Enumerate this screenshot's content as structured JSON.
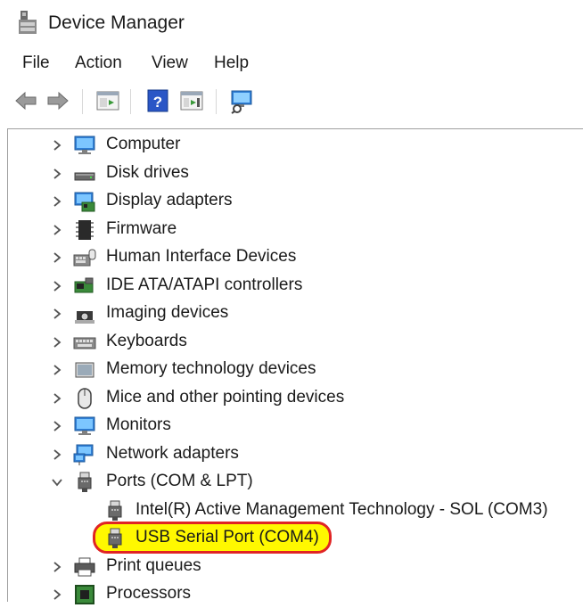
{
  "window": {
    "title": "Device Manager",
    "icon": "device-manager-icon"
  },
  "menu": [
    "File",
    "Action",
    "View",
    "Help"
  ],
  "toolbar": {
    "buttons": [
      "back-arrow-icon",
      "forward-arrow-icon",
      "properties-icon",
      "help-icon",
      "update-driver-icon",
      "scan-hardware-icon"
    ]
  },
  "tree": {
    "items": [
      {
        "label": "Computer",
        "icon": "computer-icon",
        "state": "collapsed"
      },
      {
        "label": "Disk drives",
        "icon": "disk-drive-icon",
        "state": "collapsed"
      },
      {
        "label": "Display adapters",
        "icon": "display-adapter-icon",
        "state": "collapsed"
      },
      {
        "label": "Firmware",
        "icon": "firmware-chip-icon",
        "state": "collapsed"
      },
      {
        "label": "Human Interface Devices",
        "icon": "hid-icon",
        "state": "collapsed"
      },
      {
        "label": "IDE ATA/ATAPI controllers",
        "icon": "ide-controller-icon",
        "state": "collapsed"
      },
      {
        "label": "Imaging devices",
        "icon": "camera-icon",
        "state": "collapsed"
      },
      {
        "label": "Keyboards",
        "icon": "keyboard-icon",
        "state": "collapsed"
      },
      {
        "label": "Memory technology devices",
        "icon": "memory-device-icon",
        "state": "collapsed"
      },
      {
        "label": "Mice and other pointing devices",
        "icon": "mouse-icon",
        "state": "collapsed"
      },
      {
        "label": "Monitors",
        "icon": "monitor-icon",
        "state": "collapsed"
      },
      {
        "label": "Network adapters",
        "icon": "network-adapter-icon",
        "state": "collapsed"
      },
      {
        "label": "Ports (COM & LPT)",
        "icon": "port-icon",
        "state": "expanded"
      },
      {
        "label": "Intel(R) Active Management Technology - SOL (COM3)",
        "icon": "serial-port-icon",
        "child": true
      },
      {
        "label": "USB Serial Port (COM4)",
        "icon": "serial-port-icon",
        "child": true,
        "highlighted": true
      },
      {
        "label": "Print queues",
        "icon": "printer-icon",
        "state": "collapsed"
      },
      {
        "label": "Processors",
        "icon": "processor-icon",
        "state": "collapsed"
      }
    ]
  },
  "colors": {
    "highlight_fill": "#fff800",
    "highlight_border": "#e02424",
    "chevron": "#555555"
  }
}
